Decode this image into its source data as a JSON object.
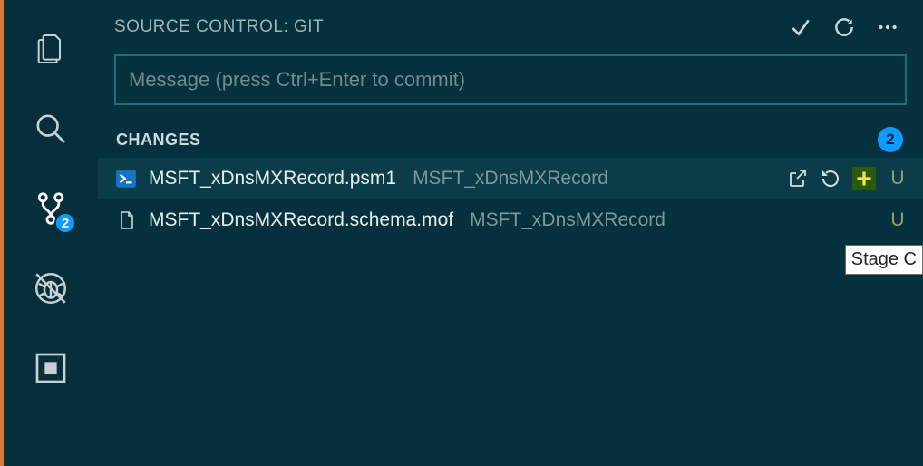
{
  "activity": {
    "scm_badge": "2"
  },
  "sourceControl": {
    "title": "SOURCE CONTROL: GIT",
    "commit_placeholder": "Message (press Ctrl+Enter to commit)",
    "section_label": "CHANGES",
    "change_count": "2",
    "files": [
      {
        "name": "MSFT_xDnsMXRecord.psm1",
        "dir": "MSFT_xDnsMXRecord",
        "status": "U",
        "icon": "powershell"
      },
      {
        "name": "MSFT_xDnsMXRecord.schema.mof",
        "dir": "MSFT_xDnsMXRecord",
        "status": "U",
        "icon": "file"
      }
    ],
    "tooltip": "Stage C"
  }
}
